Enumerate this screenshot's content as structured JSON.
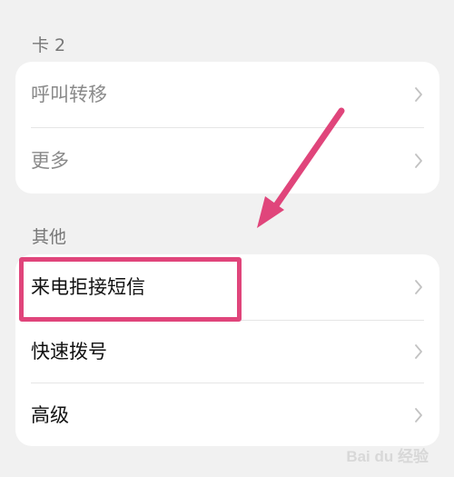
{
  "sections": {
    "sim2": {
      "label": "卡 2",
      "items": [
        {
          "label": "呼叫转移",
          "enabled": false
        },
        {
          "label": "更多",
          "enabled": false
        }
      ]
    },
    "other": {
      "label": "其他",
      "items": [
        {
          "label": "来电拒接短信",
          "enabled": true,
          "highlighted": true
        },
        {
          "label": "快速拨号",
          "enabled": true
        },
        {
          "label": "高级",
          "enabled": true
        }
      ]
    }
  },
  "annotation": {
    "highlight_color": "#e0457b",
    "arrow_color": "#e0457b"
  },
  "colors": {
    "background": "#f1f1f1",
    "card": "#ffffff",
    "disabled_text": "#8a8a8a",
    "enabled_text": "#111111"
  },
  "watermark": {
    "text": "Bai du 经验"
  }
}
